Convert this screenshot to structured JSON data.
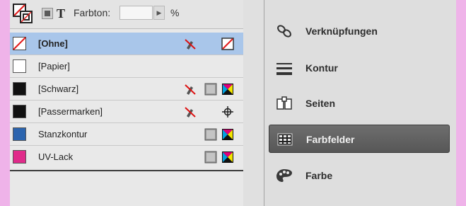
{
  "toolbar": {
    "farbton_label": "Farbton:",
    "farbton_value": "",
    "percent": "%",
    "text_mode_glyph": "T"
  },
  "swatches": [
    {
      "name": "[Ohne]",
      "color": "#ffffff",
      "selected": true
    },
    {
      "name": "[Papier]",
      "color": "#ffffff"
    },
    {
      "name": "[Schwarz]",
      "color": "#111111"
    },
    {
      "name": "[Passermarken]",
      "color": "#111111"
    },
    {
      "name": "Stanzkontur",
      "color": "#2b64ae"
    },
    {
      "name": "UV-Lack",
      "color": "#e02b8a"
    }
  ],
  "dock": {
    "items": [
      {
        "label": "Verknüpfungen",
        "icon": "links-icon"
      },
      {
        "label": "Kontur",
        "icon": "stroke-icon"
      },
      {
        "label": "Seiten",
        "icon": "pages-icon"
      },
      {
        "label": "Farbfelder",
        "icon": "swatches-icon",
        "active": true
      },
      {
        "label": "Farbe",
        "icon": "color-palette-icon"
      }
    ]
  },
  "colors": {
    "background": "#efb3e9",
    "selection": "#a9c6ea",
    "active_dock": "#5f5f5f"
  }
}
